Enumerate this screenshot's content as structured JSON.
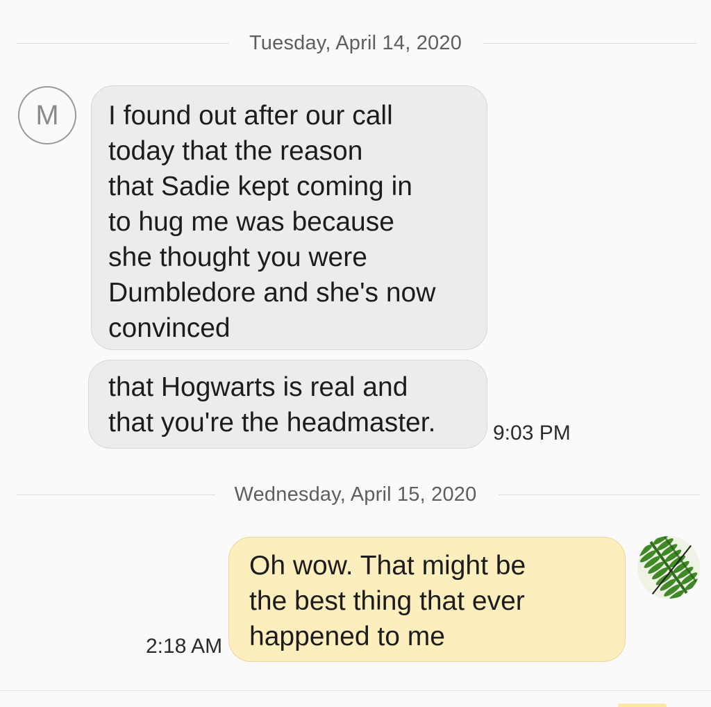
{
  "conversation": {
    "day1": {
      "date_label": "Tuesday, April 14, 2020",
      "contact_initial": "M",
      "message1_lines": [
        "I found out after our call",
        "today that the reason",
        "that Sadie kept coming in",
        "to hug me was because",
        "she thought you were",
        "Dumbledore and she's now",
        "convinced"
      ],
      "message2_lines": [
        "that Hogwarts is real and",
        "that you're the headmaster."
      ],
      "time": "9:03 PM"
    },
    "day2": {
      "date_label": "Wednesday, April 15, 2020",
      "message_lines": [
        "Oh wow. That might be",
        "the best thing that ever",
        "happened to me"
      ],
      "time": "2:18 AM",
      "sender_avatar": "fern-leaf-avatar"
    }
  },
  "colors": {
    "incoming_bubble": "#ececec",
    "outgoing_bubble": "#fdeebd",
    "divider": "#dcdcdc",
    "date_text": "#5e5e5e"
  }
}
